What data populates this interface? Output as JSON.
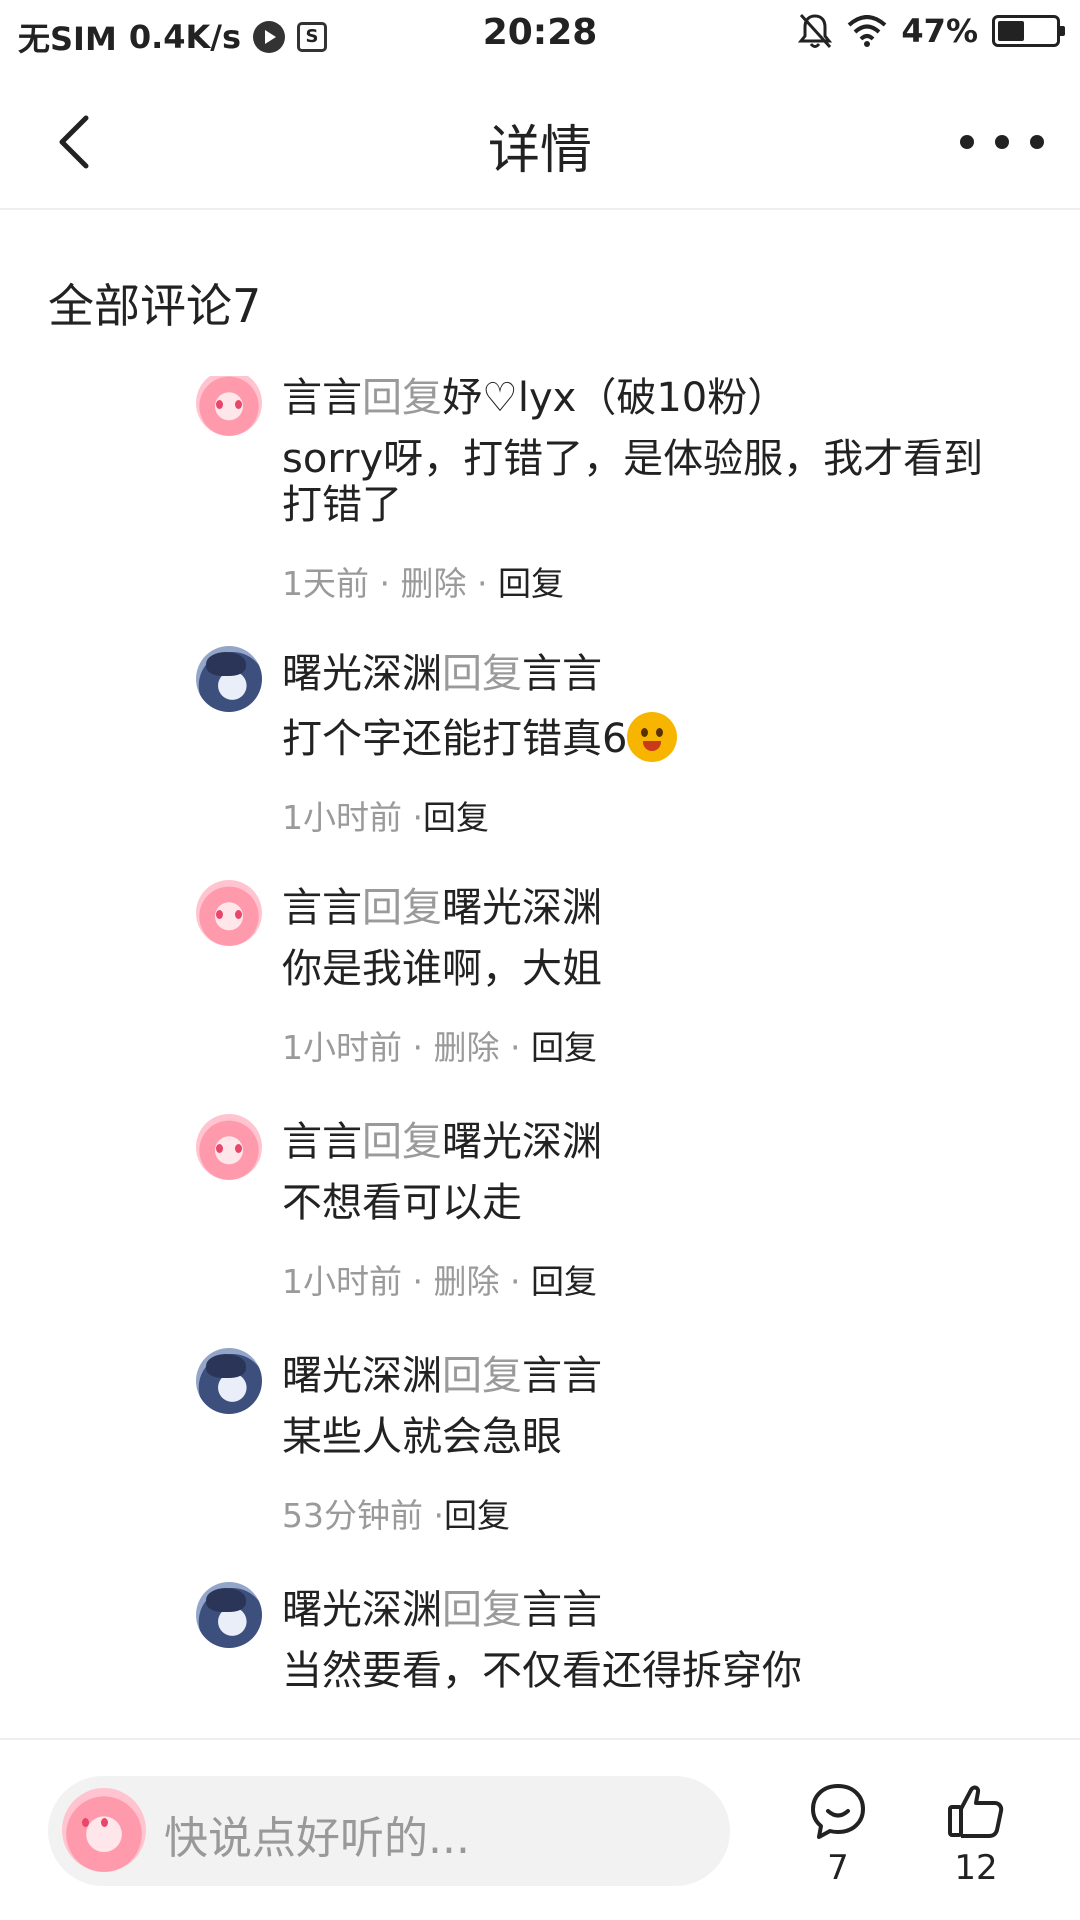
{
  "status_bar": {
    "carrier": "无SIM",
    "speed": "0.4K/s",
    "time": "20:28",
    "battery": "47%",
    "battery_level": 0.47,
    "icons": [
      "play-icon",
      "storage-icon",
      "mute-icon",
      "wifi-icon",
      "battery-icon"
    ]
  },
  "nav": {
    "title": "详情",
    "back_icon": "chevron-left-icon",
    "more_icon": "more-icon"
  },
  "section_title": "全部评论7",
  "comments": [
    {
      "avatar": "pink",
      "author": "言言",
      "reply_word": "回复",
      "target": "妤♡lyx（破10粉）",
      "text": "sorry呀，打错了，是体验服，我才看到打错了",
      "time": "1天前",
      "delete": "删除",
      "reply": "回复"
    },
    {
      "avatar": "blue",
      "author": "曙光深渊",
      "reply_word": "回复",
      "target": "言言",
      "text": "打个字还能打错真6",
      "time": "1小时前",
      "reply": "回复"
    },
    {
      "avatar": "pink",
      "author": "言言",
      "reply_word": "回复",
      "target": "曙光深渊",
      "text": "你是我谁啊，大姐",
      "time": "1小时前",
      "delete": "删除",
      "reply": "回复"
    },
    {
      "avatar": "pink",
      "author": "言言",
      "reply_word": "回复",
      "target": "曙光深渊",
      "text": "不想看可以走",
      "time": "1小时前",
      "delete": "删除",
      "reply": "回复"
    },
    {
      "avatar": "blue",
      "author": "曙光深渊",
      "reply_word": "回复",
      "target": "言言",
      "text": "某些人就会急眼",
      "time": "53分钟前",
      "reply": "回复"
    },
    {
      "avatar": "blue",
      "author": "曙光深渊",
      "reply_word": "回复",
      "target": "言言",
      "text": "当然要看，不仅看还得拆穿你"
    }
  ],
  "bottom_bar": {
    "placeholder": "快说点好听的...",
    "comment_count": "7",
    "like_count": "12",
    "comment_icon": "comment-bubble-icon",
    "like_icon": "thumbs-up-icon"
  }
}
